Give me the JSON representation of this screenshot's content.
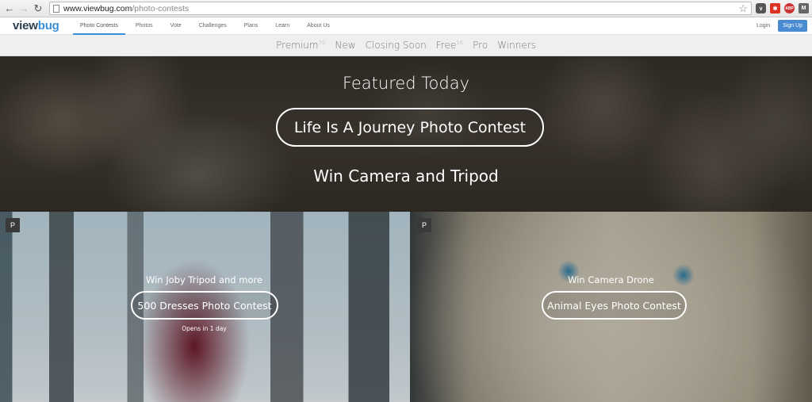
{
  "browser": {
    "url_host": "www.viewbug.com",
    "url_path": "/photo-contests",
    "back_icon": "back-arrow-icon",
    "forward_icon": "forward-arrow-icon",
    "reload_icon": "reload-icon",
    "extensions": [
      "pocket-icon",
      "lastpass-icon",
      "adblock-icon",
      "gmail-icon"
    ],
    "ext_labels": {
      "abp": "ABP",
      "m": "M"
    }
  },
  "site": {
    "logo_a": "view",
    "logo_b": "bug",
    "nav": [
      "Photo Contests",
      "Photos",
      "Vote",
      "Challenges",
      "Plans",
      "Learn",
      "About Us"
    ],
    "active_nav": "Photo Contests",
    "login": "Login",
    "signup": "Sign Up",
    "accent": "#3a8fd9"
  },
  "subnav": [
    {
      "label": "Premium",
      "count": "70"
    },
    {
      "label": "New"
    },
    {
      "label": "Closing Soon"
    },
    {
      "label": "Free",
      "count": "16"
    },
    {
      "label": "Pro"
    },
    {
      "label": "Winners"
    }
  ],
  "hero": {
    "title": "Featured Today",
    "contest": "Life Is A Journey Photo Contest",
    "prize": "Win Camera and Tripod"
  },
  "cards": [
    {
      "badge": "P",
      "prize": "Win Joby Tripod and more",
      "contest": "500 Dresses Photo Contest",
      "note": "Opens in 1 day"
    },
    {
      "badge": "P",
      "prize": "Win Camera Drone",
      "contest": "Animal Eyes Photo Contest"
    }
  ]
}
